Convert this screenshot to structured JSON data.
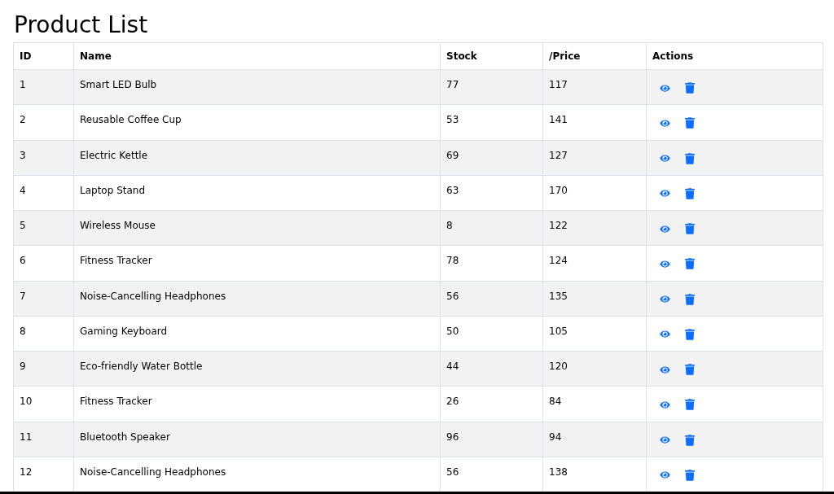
{
  "title": "Product List",
  "table": {
    "columns": [
      "ID",
      "Name",
      "Stock",
      "/Price",
      "Actions"
    ],
    "rows": [
      {
        "id": "1",
        "name": "Smart LED Bulb",
        "stock": "77",
        "price": "117"
      },
      {
        "id": "2",
        "name": "Reusable Coffee Cup",
        "stock": "53",
        "price": "141"
      },
      {
        "id": "3",
        "name": "Electric Kettle",
        "stock": "69",
        "price": "127"
      },
      {
        "id": "4",
        "name": "Laptop Stand",
        "stock": "63",
        "price": "170"
      },
      {
        "id": "5",
        "name": "Wireless Mouse",
        "stock": "8",
        "price": "122"
      },
      {
        "id": "6",
        "name": "Fitness Tracker",
        "stock": "78",
        "price": "124"
      },
      {
        "id": "7",
        "name": "Noise-Cancelling Headphones",
        "stock": "56",
        "price": "135"
      },
      {
        "id": "8",
        "name": "Gaming Keyboard",
        "stock": "50",
        "price": "105"
      },
      {
        "id": "9",
        "name": "Eco-friendly Water Bottle",
        "stock": "44",
        "price": "120"
      },
      {
        "id": "10",
        "name": "Fitness Tracker",
        "stock": "26",
        "price": "84"
      },
      {
        "id": "11",
        "name": "Bluetooth Speaker",
        "stock": "96",
        "price": "94"
      },
      {
        "id": "12",
        "name": "Noise-Cancelling Headphones",
        "stock": "56",
        "price": "138"
      }
    ]
  }
}
